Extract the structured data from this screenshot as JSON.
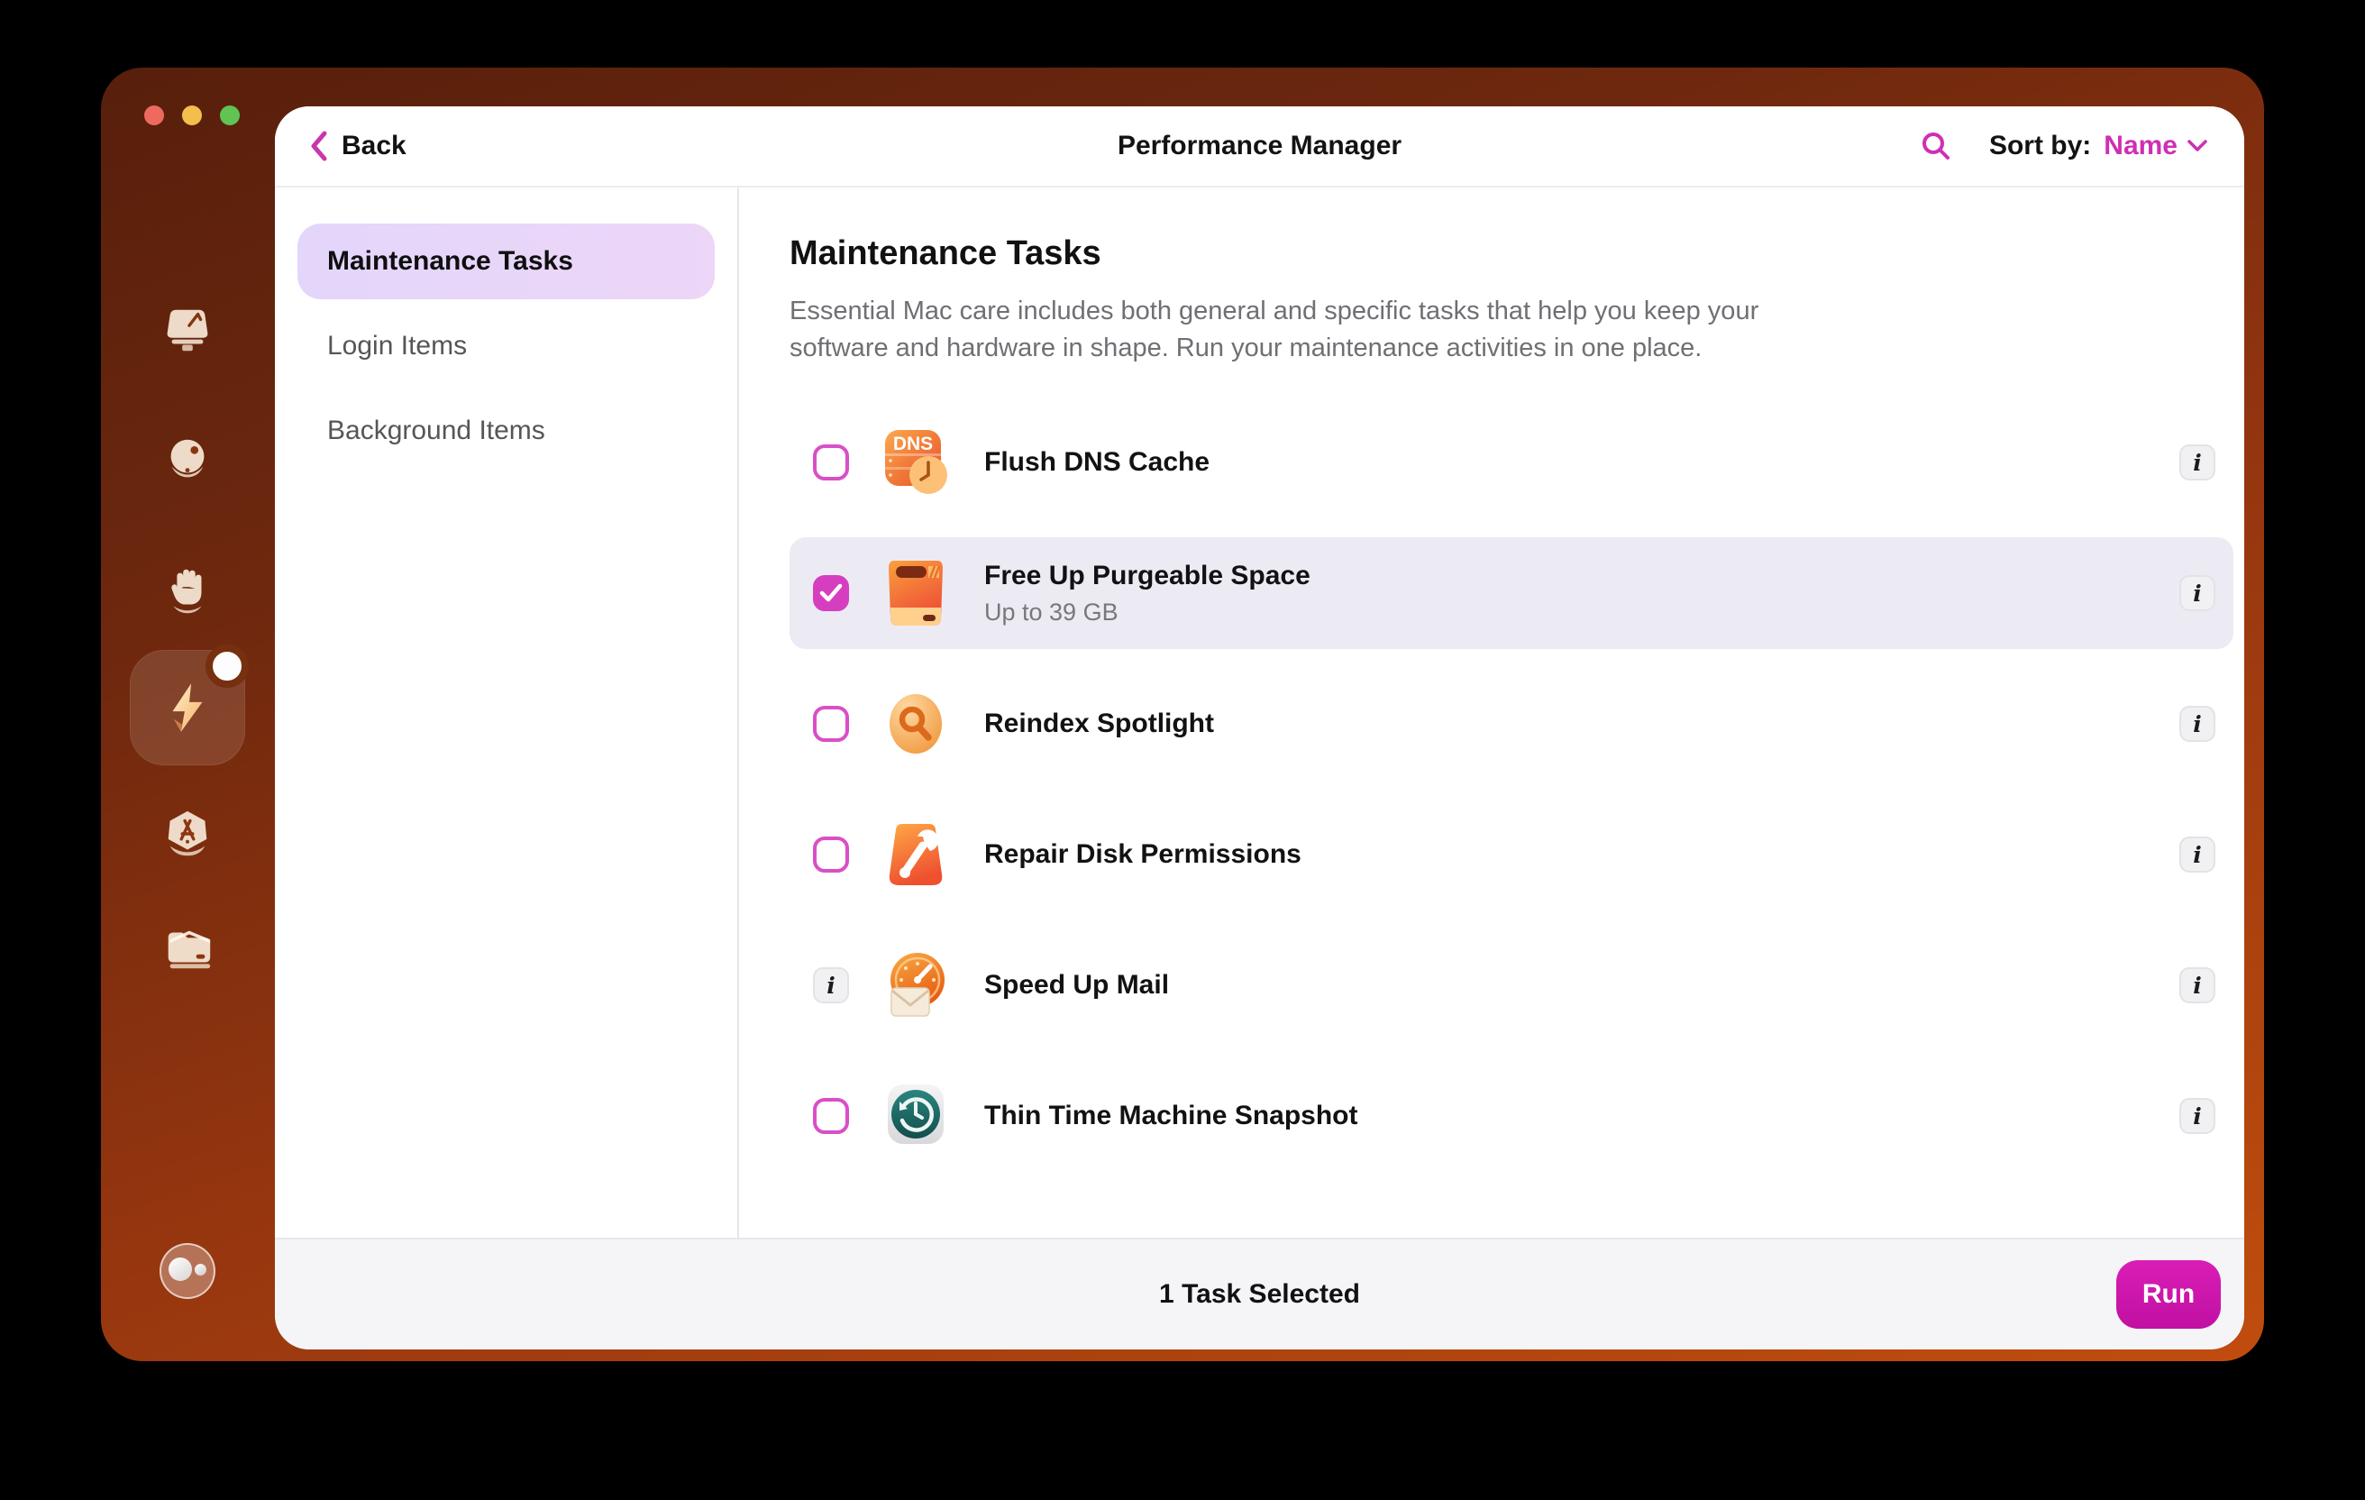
{
  "header": {
    "back_label": "Back",
    "title": "Performance Manager",
    "sort_by_label": "Sort by:",
    "sort_value": "Name"
  },
  "nav": {
    "items": [
      {
        "label": "Maintenance Tasks",
        "selected": true
      },
      {
        "label": "Login Items",
        "selected": false
      },
      {
        "label": "Background Items",
        "selected": false
      }
    ]
  },
  "main": {
    "title": "Maintenance Tasks",
    "description": "Essential Mac care includes both general and specific tasks that help you keep your software and hardware in shape. Run your maintenance activities in one place.",
    "info_badge_glyph": "i",
    "tasks": [
      {
        "title": "Flush DNS Cache",
        "icon": "dns-cache-icon",
        "checked": false
      },
      {
        "title": "Free Up Purgeable Space",
        "subtitle": "Up to 39 GB",
        "icon": "purgeable-space-drive-icon",
        "checked": true,
        "selected": true
      },
      {
        "title": "Reindex Spotlight",
        "icon": "spotlight-icon",
        "checked": false
      },
      {
        "title": "Repair Disk Permissions",
        "icon": "disk-wrench-icon",
        "checked": false
      },
      {
        "title": "Speed Up Mail",
        "icon": "mail-speedometer-icon",
        "info_left": true
      },
      {
        "title": "Thin Time Machine Snapshot",
        "icon": "time-machine-icon",
        "checked": false
      }
    ]
  },
  "footer": {
    "status": "1 Task Selected",
    "run_label": "Run"
  },
  "sidebar": {
    "modules": [
      "cleanup-mac-icon",
      "smart-orb-icon",
      "protection-hand-icon",
      "performance-bolt-icon",
      "applications-icon",
      "files-folder-icon"
    ],
    "active_module": "performance-bolt-icon",
    "has_notification": true
  },
  "colors": {
    "accent_magenta": "#CF2FB3",
    "checkbox_checked": "#D63EC0",
    "run_button": "#C010A2",
    "selected_row_bg": "#ECEBF4",
    "nav_pill_from": "#E3D6FA",
    "nav_pill_to": "#EDD6F8",
    "sidebar_gradient_top": "#571F0C",
    "sidebar_gradient_bottom": "#C04D0E"
  }
}
